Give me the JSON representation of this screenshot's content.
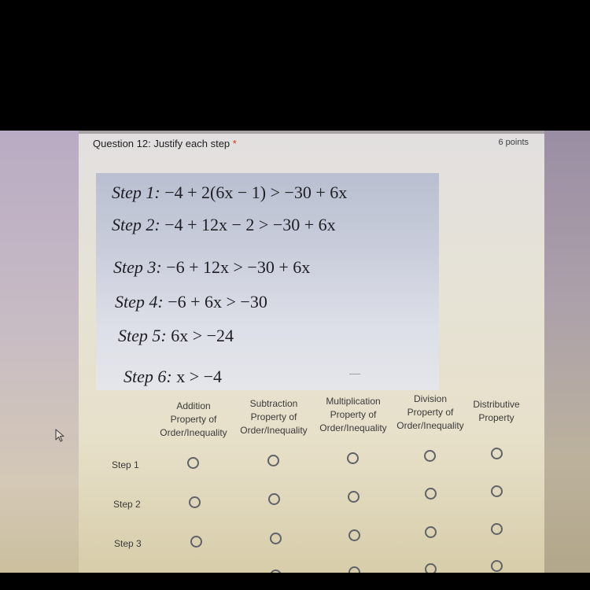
{
  "question": {
    "title": "Question 12: Justify each step",
    "required_mark": "*",
    "points": "6 points"
  },
  "problem_image": {
    "steps": [
      {
        "label": "Step 1:",
        "expression": "−4 + 2(6x − 1) > −30 + 6x"
      },
      {
        "label": "Step 2:",
        "expression": "−4 + 12x − 2 > −30 + 6x"
      },
      {
        "label": "Step 3:",
        "expression": "−6 + 12x > −30 + 6x"
      },
      {
        "label": "Step 4:",
        "expression": "−6 + 6x > −30"
      },
      {
        "label": "Step 5:",
        "expression": "6x > −24"
      },
      {
        "label": "Step 6:",
        "expression": "x > −4"
      }
    ]
  },
  "grid": {
    "columns": [
      {
        "line1": "Addition",
        "line2": "Property of",
        "line3": "Order/Inequality"
      },
      {
        "line1": "Subtraction",
        "line2": "Property of",
        "line3": "Order/Inequality"
      },
      {
        "line1": "Multiplication",
        "line2": "Property of",
        "line3": "Order/Inequality"
      },
      {
        "line1": "Division",
        "line2": "Property of",
        "line3": "Order/Inequality"
      },
      {
        "line1": "Distributive",
        "line2": "Property",
        "line3": ""
      }
    ],
    "rows": [
      {
        "label": "Step 1",
        "selected": null
      },
      {
        "label": "Step 2",
        "selected": null
      },
      {
        "label": "Step 3",
        "selected": null
      },
      {
        "label": "",
        "selected": null
      }
    ]
  },
  "icons": {
    "cursor": "mouse-pointer-arrow",
    "radio": "radio-unchecked"
  }
}
